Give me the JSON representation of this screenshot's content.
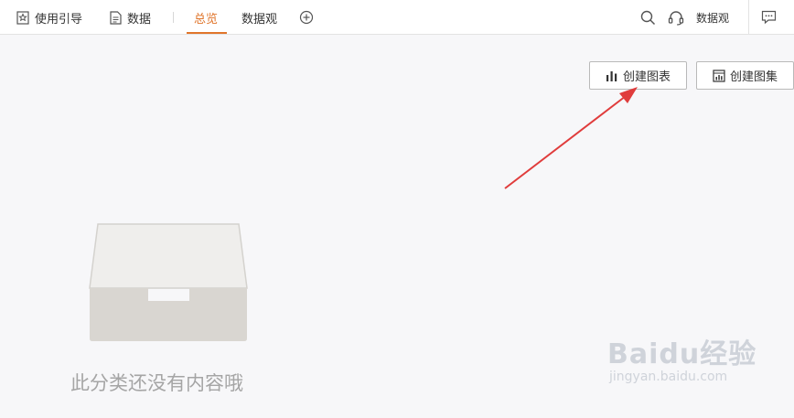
{
  "nav": {
    "guide_label": "使用引导",
    "data_label": "数据",
    "overview_tab": "总览",
    "dataview_tab": "数据观"
  },
  "header_right": {
    "user_label": "数据观"
  },
  "toolbar": {
    "create_chart_label": "创建图表",
    "create_chartset_label": "创建图集"
  },
  "empty_state": {
    "message": "此分类还没有内容哦"
  },
  "watermark": {
    "brand": "Baidu经验",
    "url": "jingyan.baidu.com"
  },
  "colors": {
    "accent": "#e0752b",
    "arrow": "#e03c3c"
  }
}
